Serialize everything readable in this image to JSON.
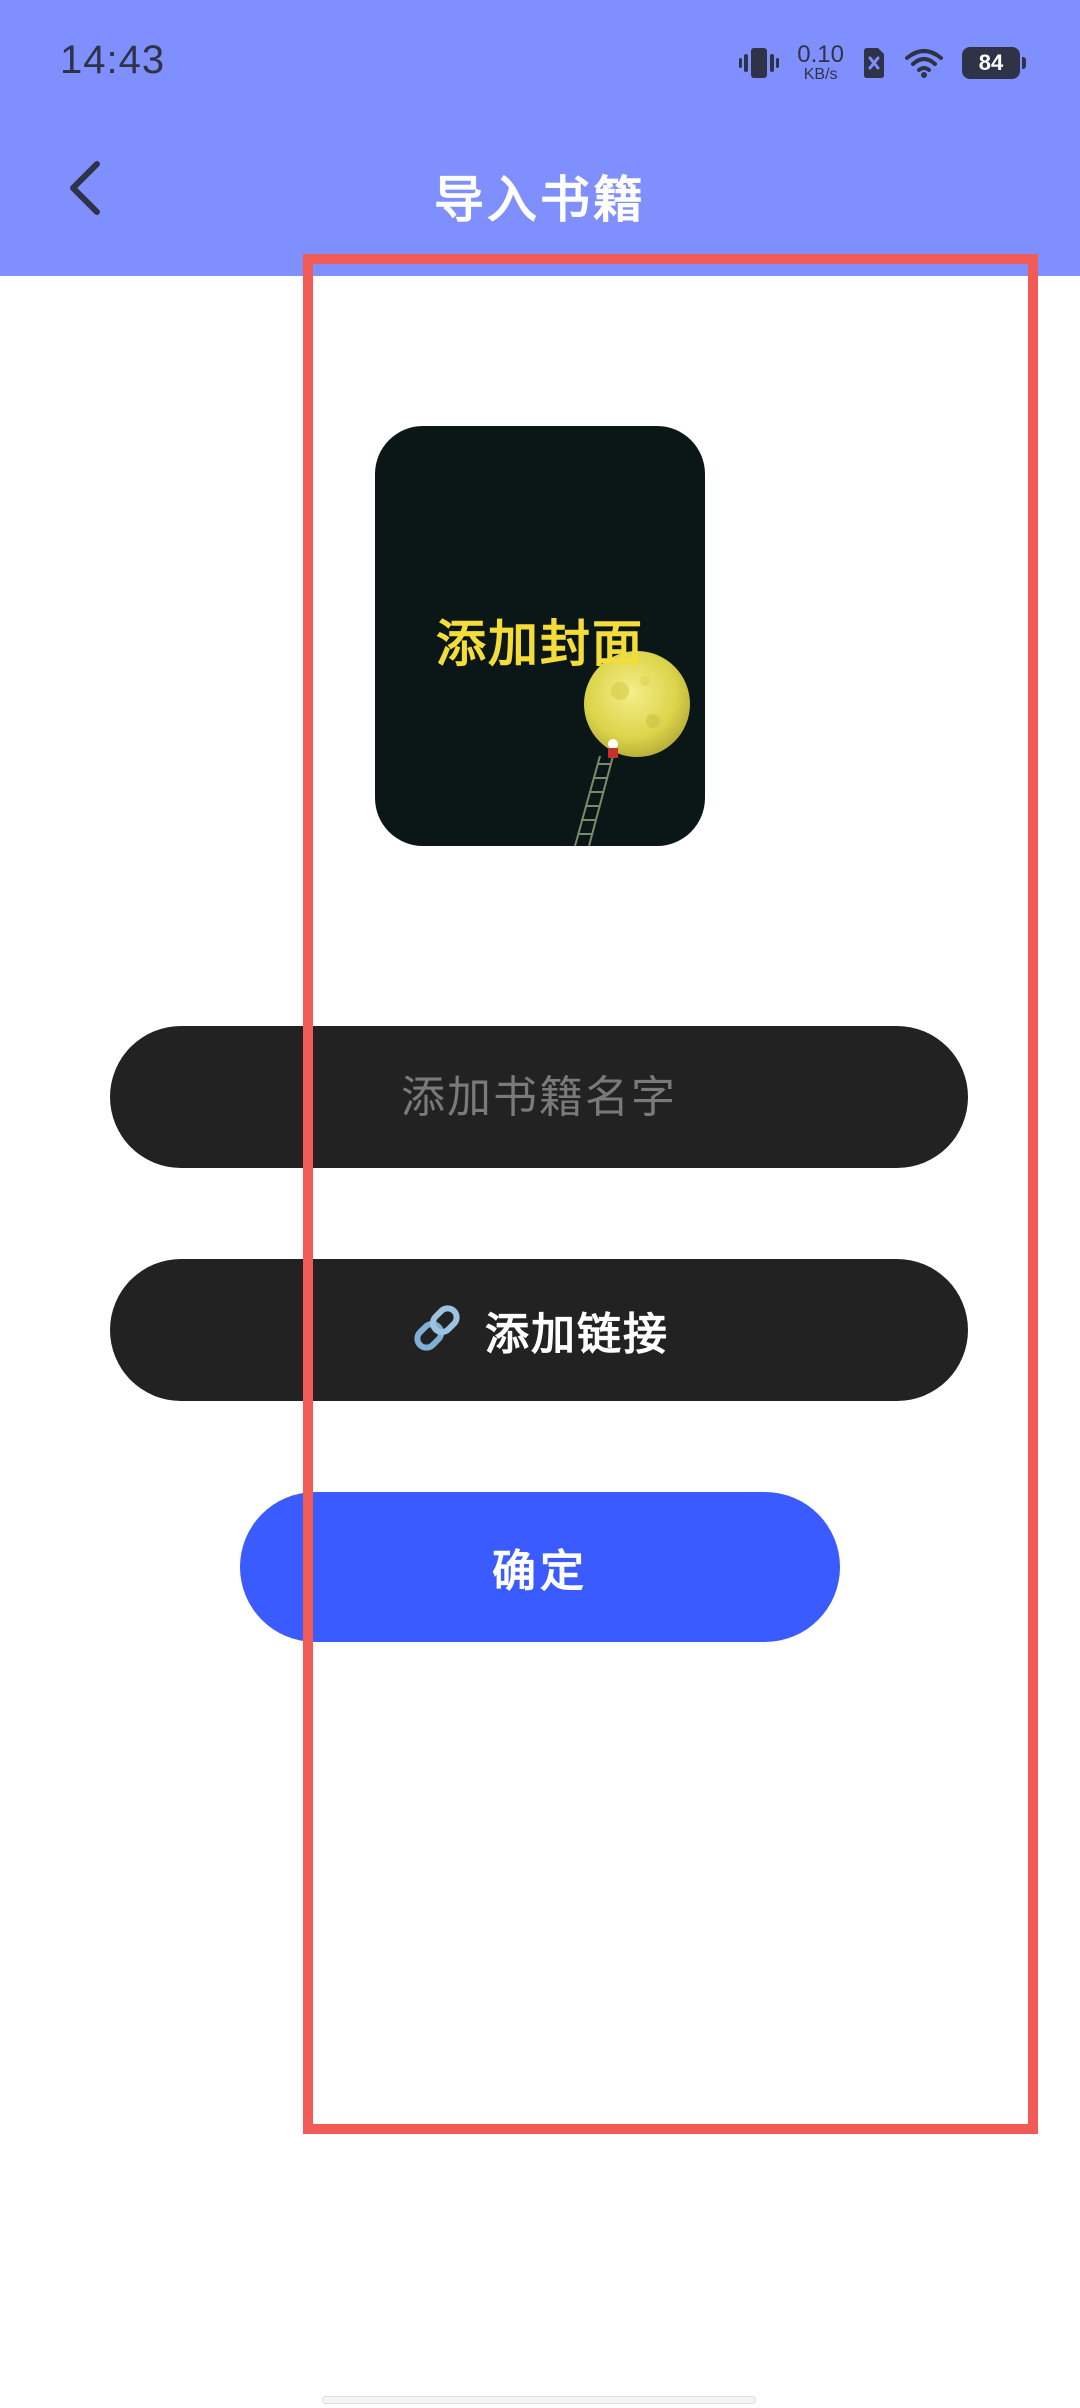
{
  "status_bar": {
    "time": "14:43",
    "net_speed_value": "0.10",
    "net_speed_unit": "KB/s",
    "battery": "84",
    "icons": [
      "vibrate-icon",
      "sim-disabled-icon",
      "wifi-icon",
      "battery-icon"
    ]
  },
  "header": {
    "title": "导入书籍",
    "back_icon": "chevron-left-icon",
    "background_color": "#7f8ffd"
  },
  "cover": {
    "label": "添加封面",
    "label_color": "#f4dc3a",
    "background_color": "#0b1716"
  },
  "form": {
    "name_placeholder": "添加书籍名字",
    "name_value": "",
    "link_label": "添加链接",
    "link_icon": "link-icon",
    "confirm_label": "确定",
    "confirm_color": "#3a5bff"
  },
  "annotation": {
    "highlight_color": "#f25a55"
  }
}
